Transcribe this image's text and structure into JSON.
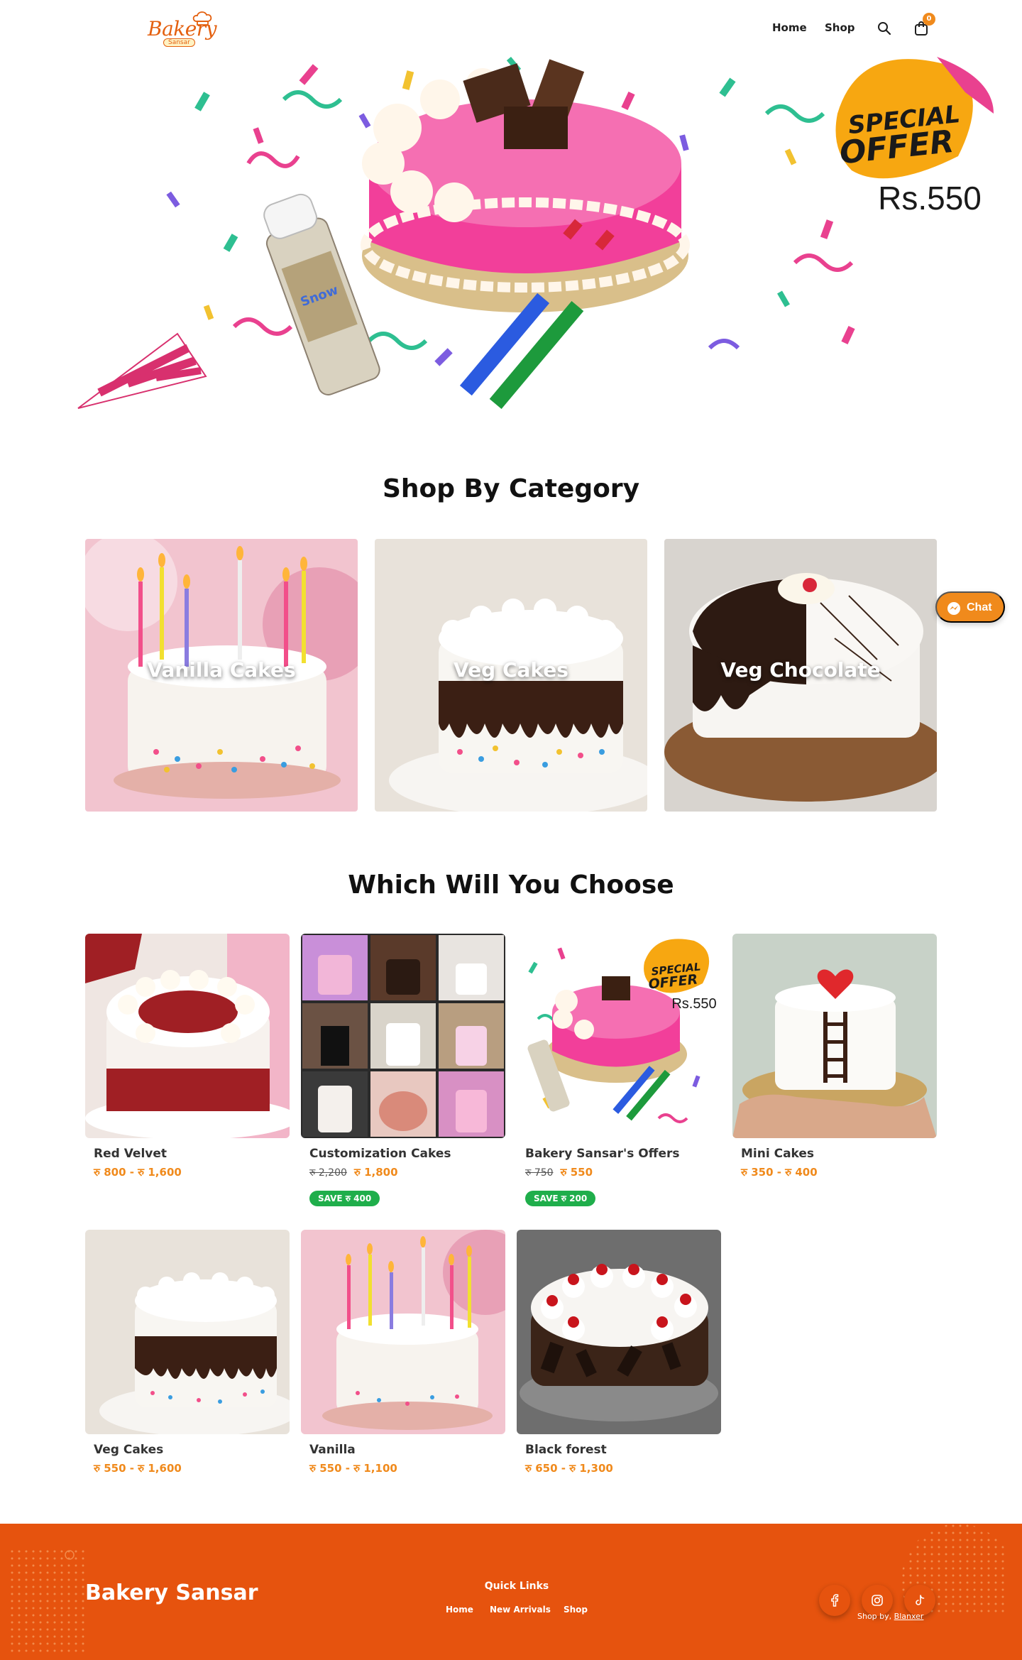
{
  "brand": {
    "logo_text": "Bakery",
    "logo_sub": "Sansar"
  },
  "nav": {
    "home": "Home",
    "shop": "Shop",
    "cart_count": "0"
  },
  "hero": {
    "badge_line1": "SPECIAL",
    "badge_line2": "OFFER",
    "price": "Rs.550"
  },
  "sections": {
    "category_title": "Shop By Category",
    "choose_title": "Which Will You Choose"
  },
  "categories": [
    {
      "label": "Vanilla Cakes"
    },
    {
      "label": "Veg Cakes"
    },
    {
      "label": "Veg Chocolate"
    }
  ],
  "chat": {
    "label": "Chat"
  },
  "products": [
    {
      "name": "Red Velvet",
      "price": "रु 800 - रु 1,600"
    },
    {
      "name": "Customization Cakes",
      "price_old": "रु 2,200",
      "price": "रु 1,800",
      "save": "SAVE रु 400"
    },
    {
      "name": "Bakery Sansar's Offers",
      "price_old": "रु 750",
      "price": "रु 550",
      "save": "SAVE रु 200",
      "badge_line1": "SPECIAL",
      "badge_line2": "OFFER",
      "badge_price": "Rs.550"
    },
    {
      "name": "Mini Cakes",
      "price": "रु 350 - रु 400"
    },
    {
      "name": "Veg Cakes",
      "price": "रु 550 - रु 1,600"
    },
    {
      "name": "Vanilla",
      "price": "रु 550 - रु 1,100"
    },
    {
      "name": "Black forest",
      "price": "रु 650 - रु 1,300"
    }
  ],
  "footer": {
    "brand": "Bakery Sansar",
    "quick_links_title": "Quick Links",
    "links": [
      "Home",
      "New Arrivals",
      "Shop"
    ],
    "credit_prefix": "Shop by,",
    "credit_link": "Blanxer"
  },
  "colors": {
    "accent": "#f08a1c",
    "footer": "#e6530e",
    "save_badge": "#1fae4b",
    "cake_pink": "#f23f9a"
  }
}
